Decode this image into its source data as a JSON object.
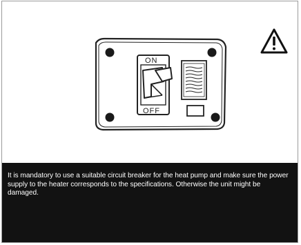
{
  "switch": {
    "on_label": "ON",
    "off_label": "OFF"
  },
  "icons": {
    "warning": "warning-triangle-icon",
    "mounting_screw": "screw-icon",
    "spec_label": "label-plate-icon",
    "indicator": "indicator-window-icon"
  },
  "notice": {
    "text": "It is mandatory to use a suitable circuit breaker for the heat pump and make sure the power supply to the heater corresponds to the specifications. Otherwise the unit might be damaged."
  },
  "colors": {
    "notice_background": "#121212",
    "notice_text": "#ffffff",
    "line_art": "#222222"
  }
}
